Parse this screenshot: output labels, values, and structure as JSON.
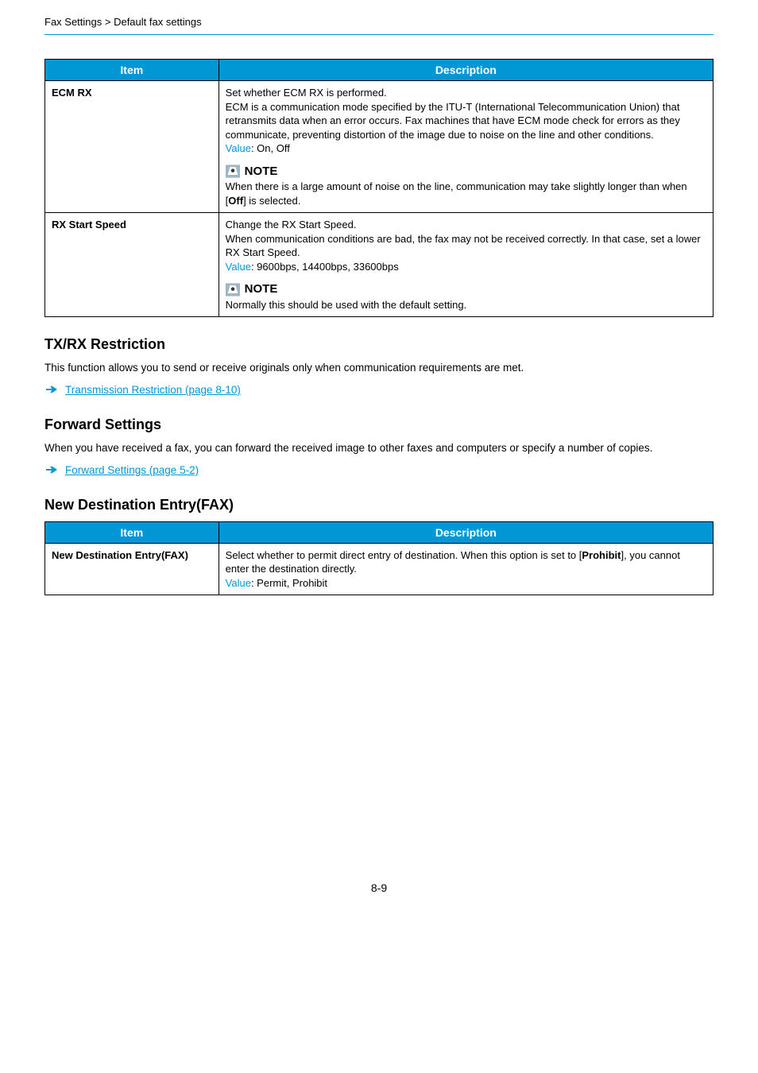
{
  "breadcrumb": "Fax Settings > Default fax settings",
  "table1": {
    "headers": {
      "item": "Item",
      "desc": "Description"
    },
    "rows": [
      {
        "item": "ECM RX",
        "desc_p1": "Set whether ECM RX is performed.",
        "desc_p2": "ECM is a communication mode specified by the ITU-T (International Telecommunication Union) that retransmits data when an error occurs. Fax machines that have ECM mode check for errors as they communicate, preventing distortion of the image due to noise on the line and other conditions.",
        "value_label": "Value",
        "value_text": ": On, Off",
        "note_label": "NOTE",
        "note_text_pre": "When there is a large amount of noise on the line, communication may take slightly longer than when [",
        "note_bold": "Off",
        "note_text_post": "] is selected."
      },
      {
        "item": "RX Start Speed",
        "desc_p1": "Change the RX Start Speed.",
        "desc_p2": "When communication conditions are bad, the fax may not be received correctly. In that case, set a lower RX Start Speed.",
        "value_label": "Value",
        "value_text": ": 9600bps, 14400bps, 33600bps",
        "note_label": "NOTE",
        "note_text": "Normally this should be used with the default setting."
      }
    ]
  },
  "section1": {
    "heading": "TX/RX Restriction",
    "body": "This function allows you to send or receive originals only when communication requirements are met.",
    "link": "Transmission Restriction (page 8-10)"
  },
  "section2": {
    "heading": "Forward Settings",
    "body": "When you have received a fax, you can forward the received image to other faxes and computers or specify a number of copies.",
    "link": "Forward Settings (page 5-2)"
  },
  "section3": {
    "heading": "New Destination Entry(FAX)"
  },
  "table2": {
    "headers": {
      "item": "Item",
      "desc": "Description"
    },
    "row": {
      "item": "New Destination Entry(FAX)",
      "desc_pre": "Select whether to permit direct entry of destination. When this option is set to [",
      "desc_bold": "Prohibit",
      "desc_post": "], you cannot enter the destination directly.",
      "value_label": "Value",
      "value_text": ": Permit, Prohibit"
    }
  },
  "page_num": "8-9"
}
